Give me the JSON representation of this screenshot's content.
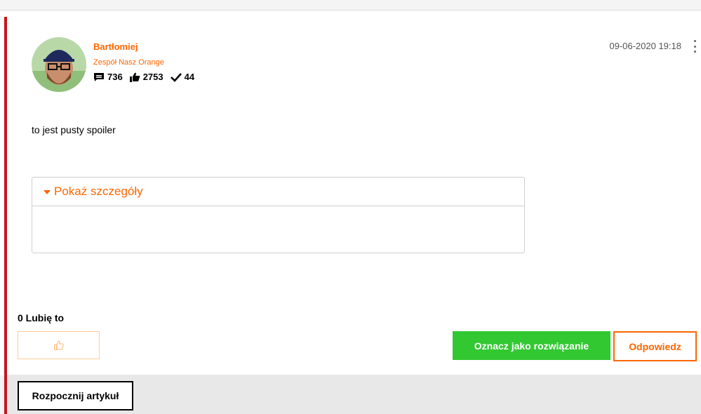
{
  "post": {
    "author": {
      "name": "Bartłomiej",
      "role": "Zespół Nasz Orange",
      "avatar_icon": "user-avatar-photo"
    },
    "stats": {
      "messages": "736",
      "messages_icon": "speech-bubble-icon",
      "kudos": "2753",
      "kudos_icon": "thumbs-up-icon",
      "solutions": "44",
      "solutions_icon": "checkmark-icon"
    },
    "timestamp": "09-06-2020 19:18",
    "body_text": "to jest pusty spoiler",
    "spoiler": {
      "label": "Pokaż szczegóły"
    },
    "likes_label": "0 Lubię to",
    "actions": {
      "mark_solution_label": "Oznacz jako rozwiązanie",
      "reply_label": "Odpowiedz"
    }
  },
  "footer": {
    "start_article_label": "Rozpocznij artykuł"
  },
  "colors": {
    "brand_orange": "#ff6600",
    "accent_red": "#c4161c",
    "solution_green": "#32c832"
  }
}
